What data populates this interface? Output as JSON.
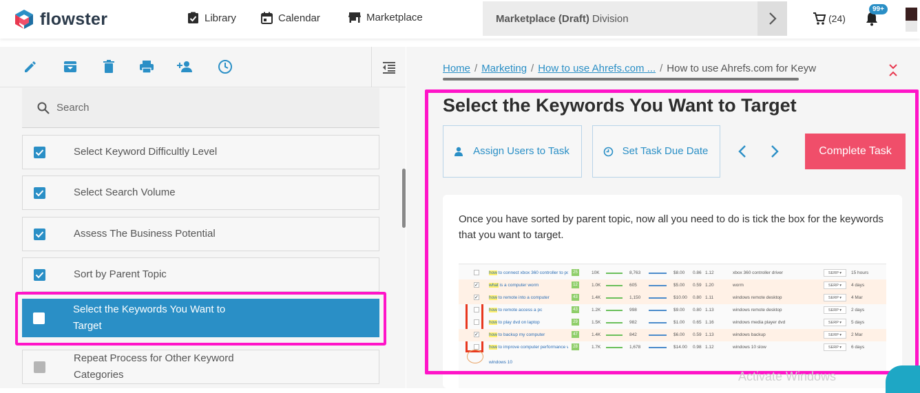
{
  "header": {
    "logo_text": "flowster",
    "nav": [
      {
        "label": "Library",
        "icon": "library-check-icon"
      },
      {
        "label": "Calendar",
        "icon": "calendar-icon"
      },
      {
        "label": "Marketplace",
        "icon": "store-icon"
      }
    ],
    "division": {
      "bold": "Marketplace (Draft)",
      "rest": " Division"
    },
    "cart_count": "(24)",
    "notification_badge": "99+"
  },
  "left": {
    "toolbar_icons": [
      "pencil-icon",
      "archive-icon",
      "trash-icon",
      "print-icon",
      "add-user-icon",
      "clock-icon"
    ],
    "search_placeholder": "Search",
    "tasks": [
      {
        "label": "Select Keyword Difficultly Level",
        "state": "checked"
      },
      {
        "label": "Select Search Volume",
        "state": "checked"
      },
      {
        "label": "Assess The Business Potential",
        "state": "checked"
      },
      {
        "label": "Sort by Parent Topic",
        "state": "checked"
      },
      {
        "label": "Select the Keywords You Want to Target",
        "state": "active"
      },
      {
        "label": "Repeat Process for Other Keyword Categories",
        "state": "disabled"
      }
    ]
  },
  "right": {
    "breadcrumbs": [
      "Home",
      "Marketing",
      "How to use Ahrefs.com ..."
    ],
    "breadcrumb_current": "How to use Ahrefs.com for Keyw",
    "title": "Select the Keywords You Want to Target",
    "assign_label": "Assign Users to Task",
    "due_label": "Set Task Due Date",
    "complete_label": "Complete Task",
    "description": "Once you have sorted by parent topic, now all you need to do is tick the box for the keywords that you want to target.",
    "watermark": "Activate Windows",
    "sheet_rows": [
      {
        "hl": "how",
        "kw": " to connect xbox 360 controller to pc",
        "kd": "25",
        "vol": "10K",
        "traffic": "8,763",
        "cpc": "$8.00",
        "c1": "0.86",
        "c2": "1.12",
        "parent": "xbox 360 controller driver",
        "updated": "15 hours",
        "checked": false,
        "highlight": false
      },
      {
        "hl": "what",
        "kw": " is a computer worm",
        "kd": "12",
        "vol": "1.0K",
        "traffic": "605",
        "cpc": "$5.00",
        "c1": "0.59",
        "c2": "1.20",
        "parent": "worm",
        "updated": "4 days",
        "checked": true,
        "highlight": true
      },
      {
        "hl": "how",
        "kw": " to remote into a computer",
        "kd": "43",
        "vol": "1.4K",
        "traffic": "1,150",
        "cpc": "$10.00",
        "c1": "0.80",
        "c2": "1.11",
        "parent": "windows remote desktop",
        "updated": "4 Mar",
        "checked": true,
        "highlight": true
      },
      {
        "hl": "how",
        "kw": " to remote access a pc",
        "kd": "43",
        "vol": "1.2K",
        "traffic": "998",
        "cpc": "$9.00",
        "c1": "0.80",
        "c2": "1.13",
        "parent": "windows remote desktop",
        "updated": "2 days",
        "checked": false,
        "highlight": false
      },
      {
        "hl": "how",
        "kw": " to play dvd on laptop",
        "kd": "29",
        "vol": "1.5K",
        "traffic": "982",
        "cpc": "$1.00",
        "c1": "0.65",
        "c2": "1.16",
        "parent": "windows media player dvd",
        "updated": "5 days",
        "checked": false,
        "highlight": false
      },
      {
        "hl": "how",
        "kw": " to backup my computer",
        "kd": "47",
        "vol": "1.4K",
        "traffic": "842",
        "cpc": "$6.00",
        "c1": "0.59",
        "c2": "1.13",
        "parent": "windows backup",
        "updated": "2 Mar",
        "checked": true,
        "highlight": true
      },
      {
        "hl": "how",
        "kw": " to improve computer performance windows 10",
        "kd": "28",
        "vol": "1.7K",
        "traffic": "1,678",
        "cpc": "$14.00",
        "c1": "0.98",
        "c2": "1.12",
        "parent": "windows 10 slow",
        "updated": "6 days",
        "checked": false,
        "highlight": false
      }
    ],
    "sheet_footer": "windows 10"
  }
}
